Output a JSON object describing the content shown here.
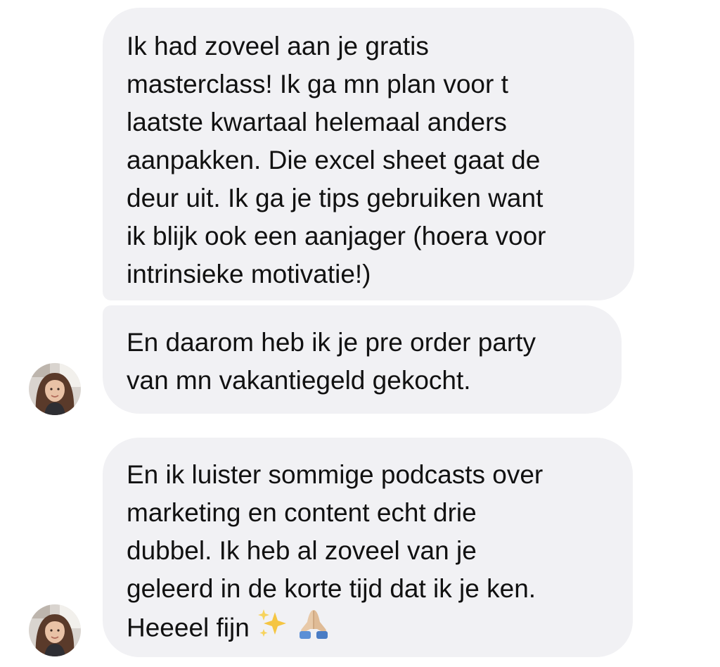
{
  "conversation": {
    "messages": [
      {
        "lines": [
          "Ik had zoveel aan je gratis",
          "masterclass! Ik ga mn plan voor t",
          "laatste kwartaal helemaal anders",
          "aanpakken. Die excel sheet gaat de",
          "deur uit. Ik ga je tips gebruiken want",
          "ik blijk ook een aanjager (hoera voor",
          "intrinsieke motivatie!)"
        ]
      },
      {
        "lines": [
          "En daarom heb ik je pre order party",
          "van mn vakantiegeld gekocht."
        ]
      },
      {
        "lines": [
          "En ik luister sommige podcasts over",
          "marketing en content echt drie",
          "dubbel. Ik heb al zoveel van je",
          "geleerd in de korte tijd dat ik je ken.",
          "Heeeel fijn"
        ],
        "emojis": [
          "sparkles-emoji",
          "folded-hands-emoji"
        ]
      }
    ]
  },
  "colors": {
    "bubble_background": "#f1f1f4",
    "text": "#111111",
    "background": "#ffffff",
    "sparkles": "#f5c542",
    "hands": "#e8c9a8"
  }
}
